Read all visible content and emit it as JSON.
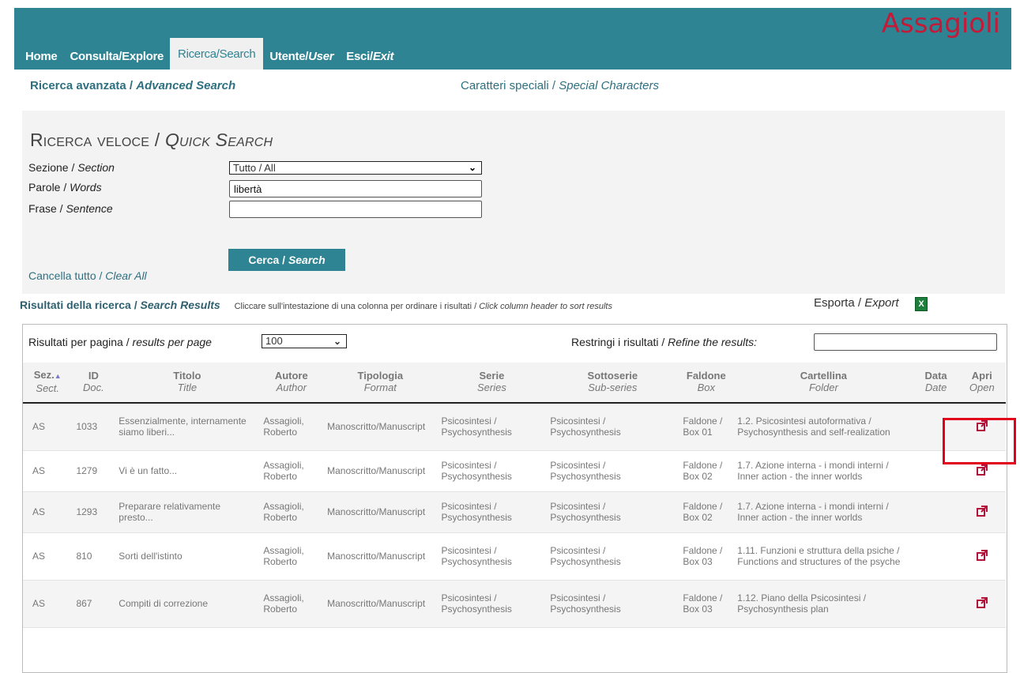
{
  "brand": "Assagioli",
  "nav": {
    "home": "Home",
    "explore": "Consulta/Explore",
    "search": "Ricerca/Search",
    "user_it": "Utente/",
    "user_en": "User",
    "exit_it": "Esci/",
    "exit_en": "Exit"
  },
  "subnav": {
    "advanced_it": "Ricerca avanzata / ",
    "advanced_en": "Advanced Search",
    "special_it": "Caratteri speciali / ",
    "special_en": "Special Characters"
  },
  "quick_search": {
    "title_it": "Ricerca veloce / ",
    "title_en": "Quick Search",
    "section_label_it": "Sezione / ",
    "section_label_en": "Section",
    "section_value": "Tutto / All",
    "words_label_it": "Parole / ",
    "words_label_en": "Words",
    "words_value": "libertà",
    "sentence_label_it": "Frase / ",
    "sentence_label_en": "Sentence",
    "sentence_value": "",
    "clear_it": "Cancella tutto / ",
    "clear_en": "Clear All",
    "search_btn_it": "Cerca / ",
    "search_btn_en": "Search"
  },
  "results": {
    "title_it": "Risultati della ricerca / ",
    "title_en": "Search Results",
    "hint_it": "Cliccare sull'intestazione di una colonna per ordinare i risultati / ",
    "hint_en": "Click column header to sort results",
    "export_it": "Esporta / ",
    "export_en": "Export",
    "per_page_it": "Risultati per pagina / ",
    "per_page_en": "results per page",
    "per_page_value": "100",
    "refine_it": "Restringi i risultati / ",
    "refine_en": "Refine the results:",
    "refine_value": ""
  },
  "columns": [
    {
      "it": "Sez.",
      "en": "Sect."
    },
    {
      "it": "ID",
      "en": "Doc."
    },
    {
      "it": "Titolo",
      "en": "Title"
    },
    {
      "it": "Autore",
      "en": "Author"
    },
    {
      "it": "Tipologia",
      "en": "Format"
    },
    {
      "it": "Serie",
      "en": "Series"
    },
    {
      "it": "Sottoserie",
      "en": "Sub-series"
    },
    {
      "it": "Faldone",
      "en": "Box"
    },
    {
      "it": "Cartellina",
      "en": "Folder"
    },
    {
      "it": "Data",
      "en": "Date"
    },
    {
      "it": "Apri",
      "en": "Open"
    }
  ],
  "rows": [
    {
      "sect": "AS",
      "id": "1033",
      "title": "Essenzialmente, internamente siamo liberi...",
      "author": "Assagioli, Roberto",
      "format": "Manoscritto/Manuscript",
      "series": "Psicosintesi / Psychosynthesis",
      "subseries": "Psicosintesi / Psychosynthesis",
      "box": "Faldone / Box 01",
      "folder": "1.2. Psicosintesi autoformativa / Psychosynthesis and self-realization",
      "date": ""
    },
    {
      "sect": "AS",
      "id": "1279",
      "title": "Vi è un fatto...",
      "author": "Assagioli, Roberto",
      "format": "Manoscritto/Manuscript",
      "series": "Psicosintesi / Psychosynthesis",
      "subseries": "Psicosintesi / Psychosynthesis",
      "box": "Faldone / Box 02",
      "folder": "1.7. Azione interna - i mondi interni / Inner action - the inner worlds",
      "date": ""
    },
    {
      "sect": "AS",
      "id": "1293",
      "title": "Preparare relativamente presto...",
      "author": "Assagioli, Roberto",
      "format": "Manoscritto/Manuscript",
      "series": "Psicosintesi / Psychosynthesis",
      "subseries": "Psicosintesi / Psychosynthesis",
      "box": "Faldone / Box 02",
      "folder": "1.7. Azione interna - i mondi interni / Inner action - the inner worlds",
      "date": ""
    },
    {
      "sect": "AS",
      "id": "810",
      "title": "Sorti dell'istinto",
      "author": "Assagioli, Roberto",
      "format": "Manoscritto/Manuscript",
      "series": "Psicosintesi / Psychosynthesis",
      "subseries": "Psicosintesi / Psychosynthesis",
      "box": "Faldone / Box 03",
      "folder": "1.11. Funzioni e struttura della psiche / Functions and structures of the psyche",
      "date": ""
    },
    {
      "sect": "AS",
      "id": "867",
      "title": "Compiti di correzione",
      "author": "Assagioli, Roberto",
      "format": "Manoscritto/Manuscript",
      "series": "Psicosintesi / Psychosynthesis",
      "subseries": "Psicosintesi / Psychosynthesis",
      "box": "Faldone / Box 03",
      "folder": "1.12. Piano della Psicosintesi / Psychosynthesis plan",
      "date": ""
    }
  ],
  "colors": {
    "header_bg": "#2e8493",
    "brand": "#c31a38",
    "open_icon": "#b0123a",
    "highlight": "#e3001b"
  }
}
